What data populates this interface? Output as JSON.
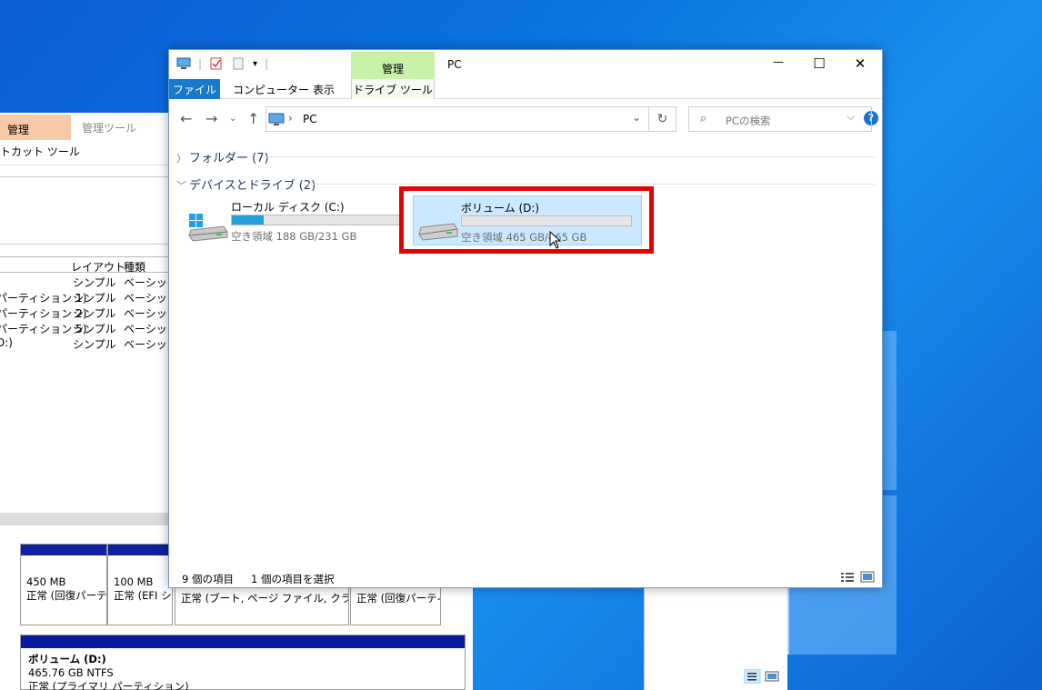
{
  "desktop": {
    "accent": "#0a6ad6"
  },
  "background_window": {
    "ribbon_tab_kanri": "管理",
    "ribbon_tab_tool": "管理ツール",
    "ribbon_sub": "トカット ツール",
    "columns": [
      "レイアウト",
      "種類"
    ],
    "rows": [
      {
        "name": "",
        "layout": "シンプル",
        "type": "ベーシック"
      },
      {
        "name": "パーティション 1)",
        "layout": "シンプル",
        "type": "ベーシック"
      },
      {
        "name": "パーティション 2)",
        "layout": "シンプル",
        "type": "ベーシック"
      },
      {
        "name": "パーティション 5)",
        "layout": "シンプル",
        "type": "ベーシック"
      },
      {
        "name": "D:)",
        "layout": "シンプル",
        "type": "ベーシック"
      }
    ],
    "partitions": [
      {
        "size": "450 MB",
        "status": "正常 (回復パーテ"
      },
      {
        "size": "100 MB",
        "status": "正常 (EFI シ"
      },
      {
        "size": "",
        "status": "正常 (ブート, ページ ファイル, クラッシュ"
      },
      {
        "size": "",
        "status": "正常 (回復パーティ"
      }
    ],
    "volume": {
      "name": "ボリューム  (D:)",
      "size": "465.76 GB NTFS",
      "status": "正常 (プライマリ パーティション)"
    }
  },
  "explorer": {
    "title": "PC",
    "context_tab": "管理",
    "tabs": {
      "file": "ファイル",
      "computer": "コンピューター",
      "view": "表示",
      "drive_tools": "ドライブ ツール"
    },
    "controls": {
      "minimize": "—",
      "maximize": "☐",
      "close": "✕"
    },
    "help": "?",
    "address": "PC",
    "search_placeholder": "PCの検索",
    "groups": {
      "folders": "フォルダー (7)",
      "devices": "デバイスとドライブ (2)"
    },
    "drives": [
      {
        "name": "ローカル ディスク (C:)",
        "free": "空き領域 188 GB/231 GB",
        "used_fraction": 0.19
      },
      {
        "name": "ボリューム (D:)",
        "free": "空き領域 465 GB/465 GB",
        "used_fraction": 0.0
      }
    ],
    "status": {
      "items": "9 個の項目",
      "selected": "1 個の項目を選択"
    }
  }
}
